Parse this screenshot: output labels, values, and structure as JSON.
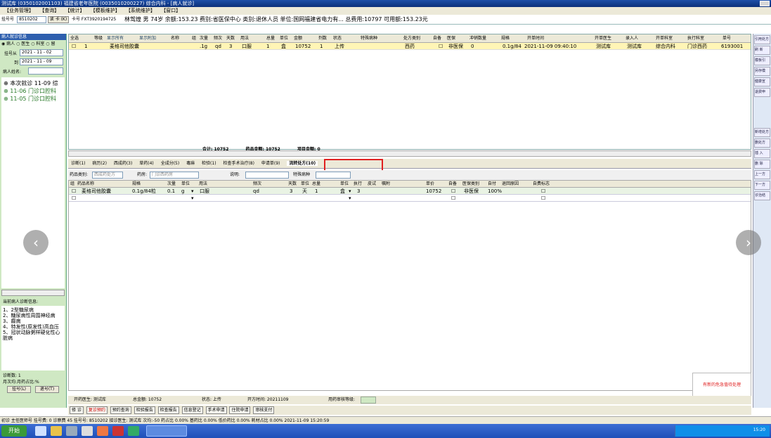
{
  "window": {
    "title": "测试库 (0350102001103) 福建省老年医院 (0035010200227) 综合内科 - [病人就诊]"
  },
  "menu": [
    "【业务管理】",
    "【查询】",
    "【统计】",
    "【模板维护】",
    "【系统维护】",
    "【窗口】"
  ],
  "infobar": {
    "reg_label": "挂号号",
    "reg_value": "8510202",
    "read_card": "读 卡 (K)",
    "card_no": "卡号 FXT3920194725",
    "patient": "林驾煌 男 74岁 余额:153.23 费别:省医保中心 类别:退休人员 单位:国网福建省电力有... 总费用:10797 可用额:153.23元"
  },
  "left": {
    "header": "病人就诊信息",
    "radios": [
      "病人",
      "医生",
      "科室",
      "留"
    ],
    "date_from_label": "挂号从",
    "date_from": "2021 - 11 - 02",
    "date_to_label": "到",
    "date_to": "2021 - 11 - 09",
    "name_label": "病人姓名:",
    "visits": [
      "本次就诊 11-09 综",
      "11-06 门诊口腔科",
      "11-05 门诊口腔科"
    ],
    "diag_header": "当前病人诊断信息:",
    "diagnoses": [
      "1、2型糖尿病",
      "2、糖尿病性周围神经病",
      "3、癫病",
      "4、特发性(原发性)高血压",
      "5、冠状动脉粥样硬化性心脏病"
    ],
    "diag_count": "诊断数: 1",
    "monthly": "月次均:月药占比:%",
    "reg_btn": "挂号(L)",
    "ret_btn": "退号(T)"
  },
  "main_grid": {
    "headers": [
      "全选",
      "等级",
      "显示所有",
      "显示附加",
      "名称",
      "组",
      "次量",
      "频次",
      "天数",
      "用法",
      "总量",
      "单位",
      "金额",
      "剂数",
      "状态",
      "特殊病种",
      "处方类别",
      "自备",
      "医保",
      "冲销数量",
      "规格",
      "开单时间",
      "开单医生",
      "录入人",
      "开单科室",
      "执行科室",
      "单号"
    ],
    "row": {
      "idx": "1",
      "name": "麦格司他胶囊",
      "dose": ".1g",
      "freq": "qd",
      "days": "3",
      "usage": "口服",
      "qty": "1",
      "unit": "盒",
      "amount": "10752",
      "doses": "1",
      "status": "上传",
      "rx_type": "西药",
      "insurance": "非医保",
      "offset": "0",
      "spec": "0.1g/84",
      "time": "2021-11-09 09:40:10",
      "doctor": "测试库",
      "entry": "测试库",
      "dept": "综合内科",
      "exec": "门诊西药",
      "no": "6193001"
    },
    "totals": {
      "sum_label": "合计:",
      "sum": "10752",
      "drug_label": "药品金额:",
      "drug": "10752",
      "item_label": "项目金额:",
      "item": "0"
    }
  },
  "tabs": [
    "诊断(1)",
    "病历(2)",
    "西成药(3)",
    "草药(4)",
    "全成分(5)",
    "毒麻",
    "检验(1)",
    "检查手术治疗(8)",
    "申请单(9)",
    "流转处方(10)"
  ],
  "filter": {
    "drug_type_label": "药品类别:",
    "drug_type": "西成药处方",
    "pharmacy_label": "药房:",
    "pharmacy": "门诊西药房",
    "desc_label": "说明:",
    "special_label": "特殊病种"
  },
  "child_grid": {
    "headers": [
      "组",
      "药品名称",
      "规格",
      "次量",
      "单位",
      "用法",
      "频次",
      "天数",
      "单位",
      "总量",
      "单位",
      "执行",
      "皮试",
      "嘱附",
      "单价",
      "自备",
      "医保类别",
      "自付",
      "退回原因",
      "自费标志"
    ],
    "row": {
      "name": "麦格司他胶囊",
      "spec": "0.1g/84粒",
      "dose": "0.1",
      "dose_unit": "g",
      "usage": "口服",
      "freq": "qd",
      "days": "3",
      "days_unit": "天",
      "qty": "1",
      "qty_unit": "盒",
      "exec": "3",
      "price": "10752",
      "insurance": "非医保",
      "self_pay": "100%"
    }
  },
  "right": [
    "引用处方",
    "刷 新",
    "模板引",
    "另存模",
    "健康宣",
    "退费申",
    "新增处方",
    "删处方",
    "插 入",
    "删 除",
    "上一方",
    "下一方",
    "诊治结"
  ],
  "status": {
    "doctor": "开药医生: 测试库",
    "total": "总金额: 10752",
    "state": "状态: 上传",
    "date": "开方时间: 20211109",
    "audit": "用药审核等级:"
  },
  "actions": [
    "修 诊",
    "复诊预约",
    "预约查询",
    "检验报告",
    "检查报告",
    "信息登记",
    "手术申请",
    "住院申请",
    "审核支付"
  ],
  "bottom": "初诊 主任医师号   挂号费: 0   诊察费 45   挂号号: 8510202   接诊医生: 测试库  次均:-50  药占比 0.00%  基药比 0.00%  低价药比 0.00%  耗材占比 0.00%  2021-11-09 15:20:59",
  "popup": "有新的危急值待处理",
  "taskbar": {
    "start": "开始",
    "time": "15:20"
  }
}
